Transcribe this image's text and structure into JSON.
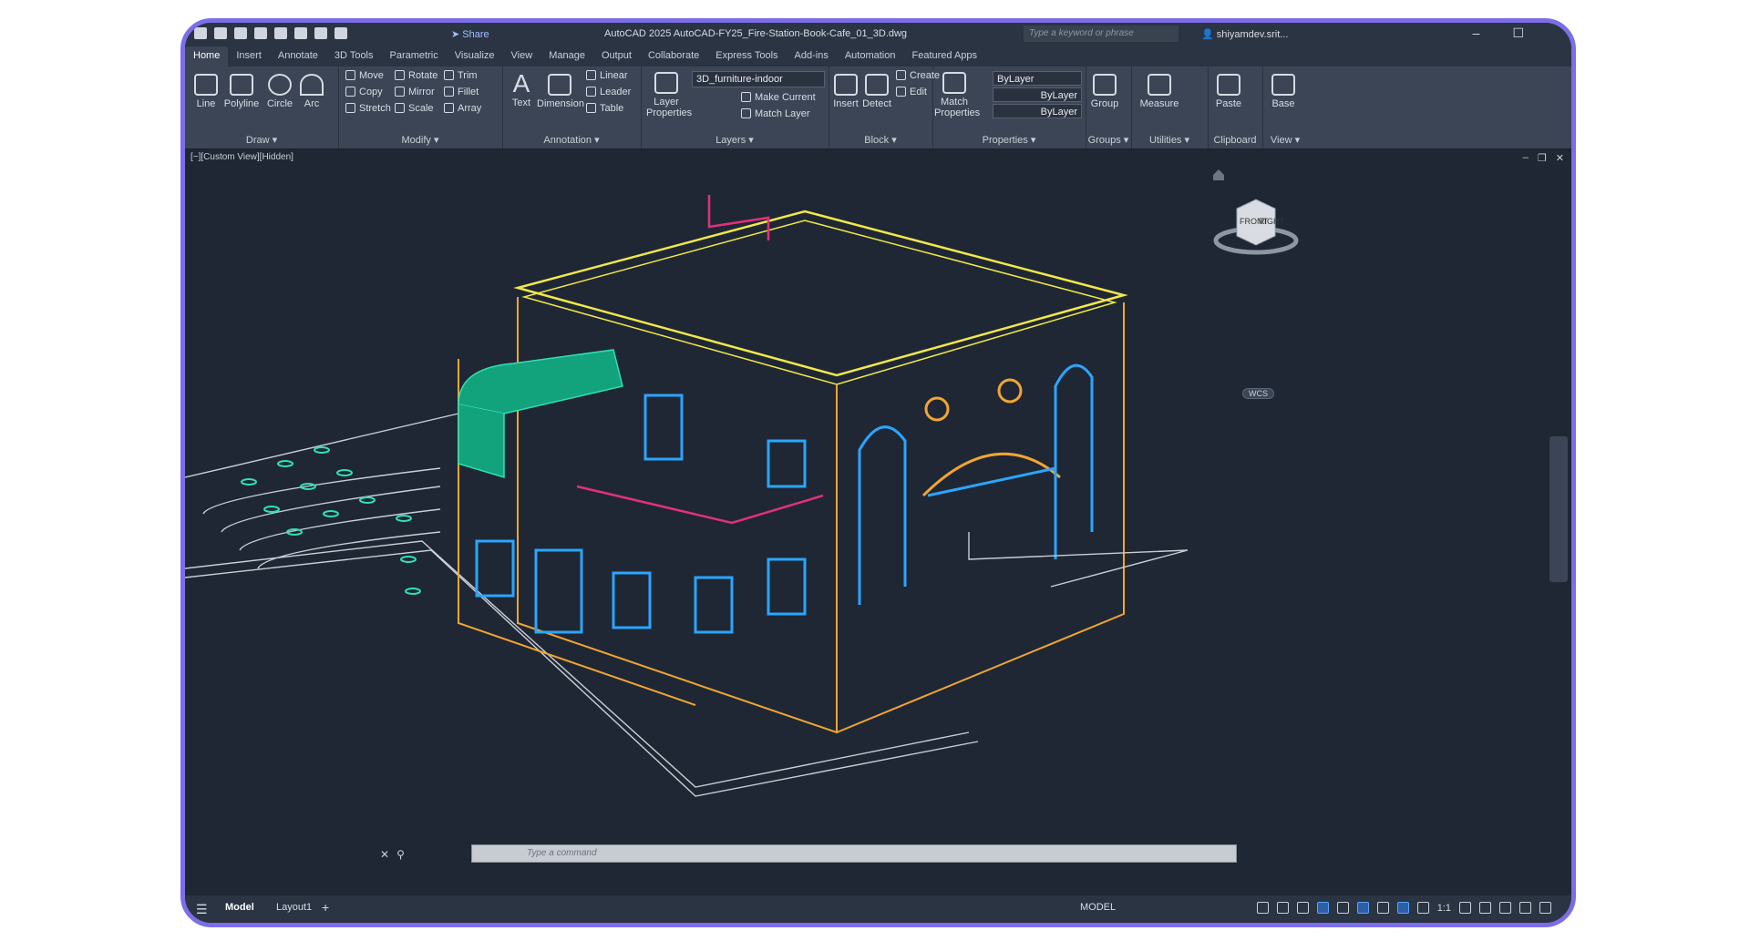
{
  "titlebar": {
    "share_label": "Share",
    "title": "AutoCAD 2025   AutoCAD-FY25_Fire-Station-Book-Cafe_01_3D.dwg",
    "search_placeholder": "Type a keyword or phrase",
    "user": "shiyamdev.srit..."
  },
  "tabs": [
    "Home",
    "Insert",
    "Annotate",
    "3D Tools",
    "Parametric",
    "Visualize",
    "View",
    "Manage",
    "Output",
    "Collaborate",
    "Express Tools",
    "Add-ins",
    "Automation",
    "Featured Apps"
  ],
  "ribbon": {
    "draw": {
      "title": "Draw",
      "line": "Line",
      "polyline": "Polyline",
      "circle": "Circle",
      "arc": "Arc"
    },
    "modify": {
      "title": "Modify",
      "move": "Move",
      "copy": "Copy",
      "stretch": "Stretch",
      "rotate": "Rotate",
      "mirror": "Mirror",
      "scale": "Scale",
      "trim": "Trim",
      "fillet": "Fillet",
      "array": "Array"
    },
    "annotation": {
      "title": "Annotation",
      "text": "Text",
      "dimension": "Dimension",
      "linear": "Linear",
      "leader": "Leader",
      "table": "Table"
    },
    "layers": {
      "title": "Layers",
      "layer_properties": "Layer\nProperties",
      "current_layer": "3D_furniture-indoor",
      "make_current": "Make Current",
      "match_layer": "Match Layer"
    },
    "block": {
      "title": "Block",
      "insert": "Insert",
      "detect": "Detect",
      "create": "Create",
      "edit": "Edit"
    },
    "properties": {
      "title": "Properties",
      "match_properties": "Match\nProperties",
      "color": "ByLayer",
      "linetype": "ByLayer",
      "lineweight": "ByLayer"
    },
    "groups": {
      "title": "Groups",
      "group": "Group"
    },
    "utilities": {
      "title": "Utilities",
      "measure": "Measure"
    },
    "clipboard": {
      "title": "Clipboard",
      "paste": "Paste"
    },
    "view": {
      "title": "View",
      "base": "Base"
    }
  },
  "viewport": {
    "label": "[−][Custom View][Hidden]",
    "viewcube_front": "FRONT",
    "viewcube_right": "RIGHT",
    "wcs": "WCS"
  },
  "command": {
    "placeholder": "Type a command"
  },
  "status": {
    "model_tab": "Model",
    "layout_tab": "Layout1",
    "model_label": "MODEL",
    "scale": "1:1"
  }
}
